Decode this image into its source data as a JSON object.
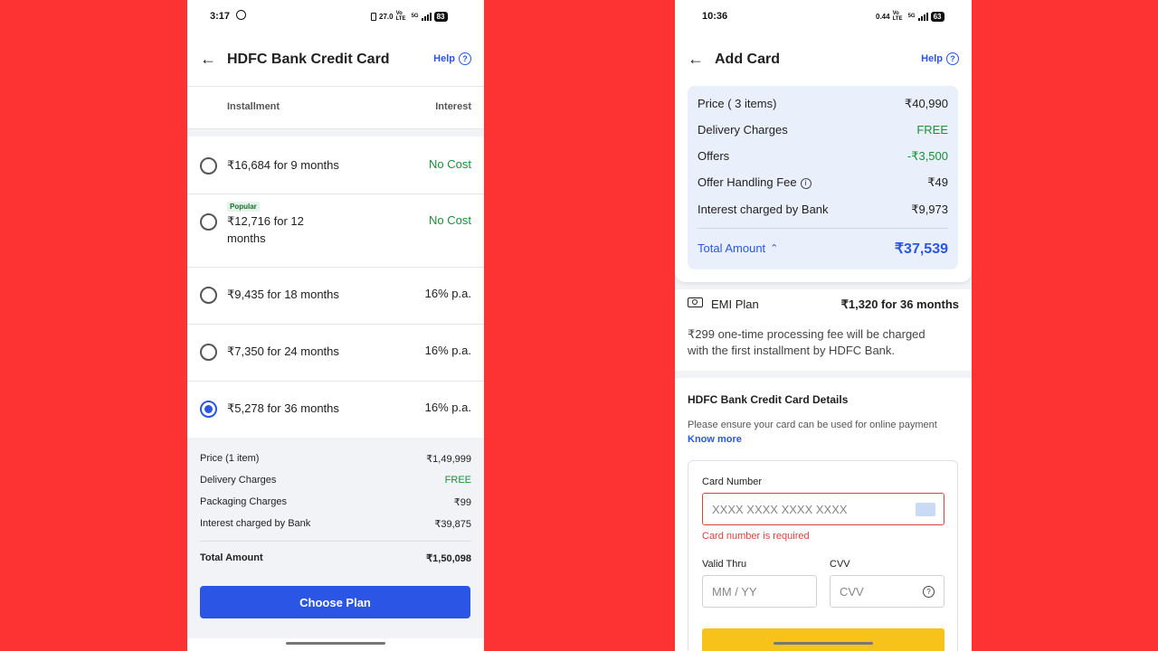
{
  "left_phone": {
    "status": {
      "time": "3:17",
      "net_speed": "27.0",
      "net_unit": "KB/S",
      "vo_lte": "Vo LTE",
      "gen": "5G",
      "battery": "83"
    },
    "appbar": {
      "title": "HDFC Bank Credit Card",
      "help": "Help"
    },
    "table_headers": {
      "installment": "Installment",
      "interest": "Interest"
    },
    "plans": [
      {
        "label": "₹16,684 for 9 months",
        "interest": "No Cost",
        "selected": false
      },
      {
        "badge": "Popular",
        "label_line1": "₹12,716 for 12",
        "label_line2": "months",
        "interest": "No Cost",
        "selected": false
      },
      {
        "label": "₹9,435 for 18 months",
        "interest": "16% p.a.",
        "selected": false
      },
      {
        "label": "₹7,350 for 24 months",
        "interest": "16% p.a.",
        "selected": false
      },
      {
        "label": "₹5,278 for 36 months",
        "interest": "16% p.a.",
        "selected": true
      }
    ],
    "summary": {
      "price_label": "Price (1 item)",
      "price_value": "₹1,49,999",
      "delivery_label": "Delivery Charges",
      "delivery_value": "FREE",
      "packaging_label": "Packaging Charges",
      "packaging_value": "₹99",
      "interest_label": "Interest charged by Bank",
      "interest_value": "₹39,875",
      "total_label": "Total Amount",
      "total_value": "₹1,50,098"
    },
    "button": "Choose Plan"
  },
  "right_phone": {
    "status": {
      "time": "10:36",
      "net_speed": "0.44",
      "net_unit": "KB/S",
      "vo_lte": "Vo LTE",
      "gen": "5G",
      "battery": "63"
    },
    "appbar": {
      "title": "Add Card",
      "help": "Help"
    },
    "price_box": {
      "price_label": "Price ( 3 items)",
      "price_value": "₹40,990",
      "delivery_label": "Delivery Charges",
      "delivery_value": "FREE",
      "offers_label": "Offers",
      "offers_value": "-₹3,500",
      "handling_label": "Offer Handling Fee",
      "handling_value": "₹49",
      "interest_label": "Interest charged by Bank",
      "interest_value": "₹9,973",
      "total_label": "Total Amount",
      "total_value": "₹37,539"
    },
    "emi": {
      "label": "EMI Plan",
      "value": "₹1,320 for 36 months",
      "note_line1": "₹299 one-time processing fee will be charged",
      "note_line2": "with the first installment by HDFC Bank."
    },
    "card_details": {
      "title": "HDFC Bank Credit Card Details",
      "note": "Please ensure your card can be used for online payment",
      "know_more": "Know more",
      "card_number_label": "Card Number",
      "card_number_placeholder": "XXXX XXXX XXXX XXXX",
      "card_number_error": "Card number is required",
      "valid_thru_label": "Valid Thru",
      "valid_thru_placeholder": "MM / YY",
      "cvv_label": "CVV",
      "cvv_placeholder": "CVV"
    },
    "colors": {
      "accent": "#2a55e5",
      "error": "#d9453c",
      "success": "#1c8d3a",
      "cta_yellow": "#f7c31a"
    }
  }
}
